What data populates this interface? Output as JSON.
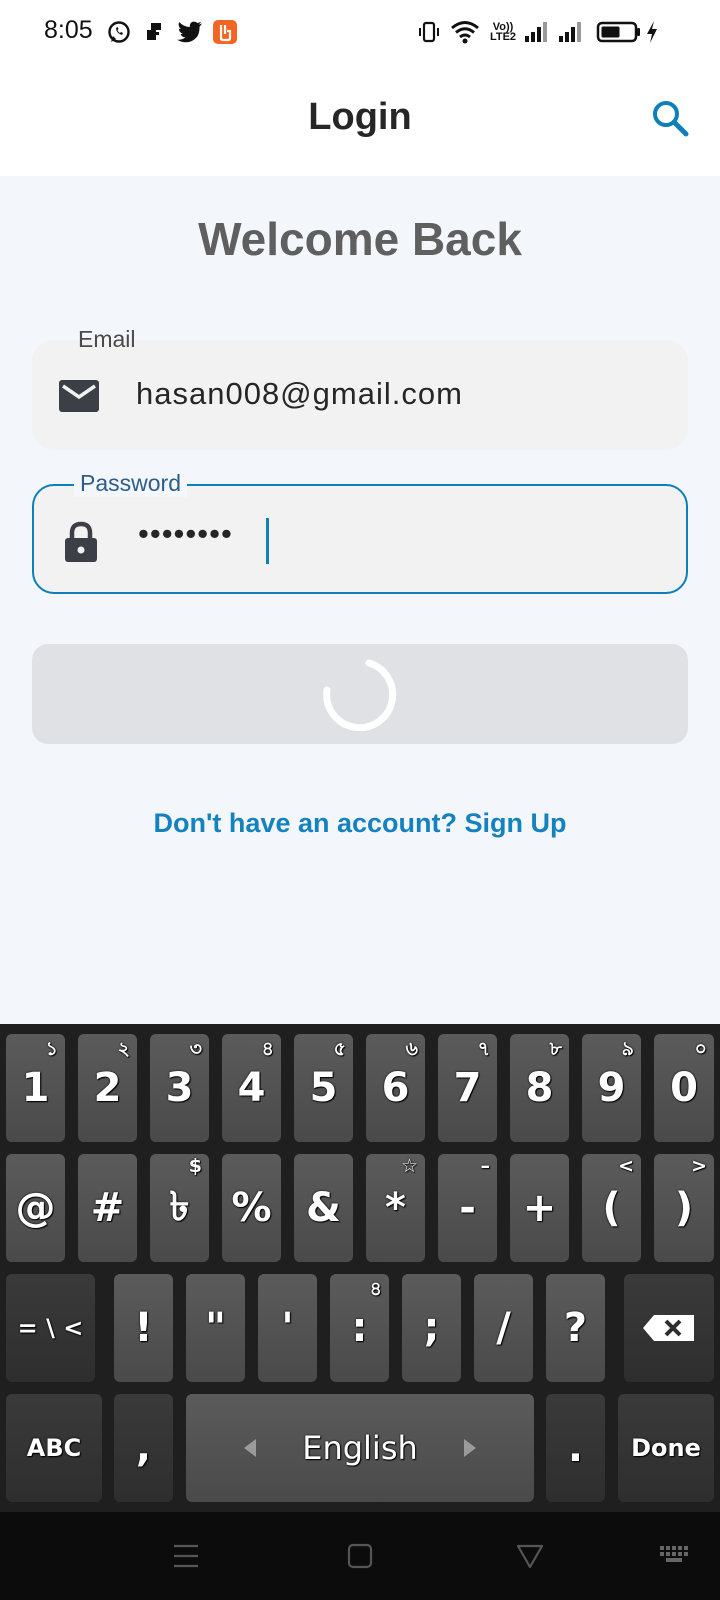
{
  "status_bar": {
    "time": "8:05",
    "notification_icons": [
      "whatsapp-icon",
      "app-notification-icon",
      "twitter-icon",
      "app-orange-icon"
    ],
    "vo_lte_line1": "Vo))",
    "vo_lte_line2": "LTE2",
    "system_icons": [
      "vibrate-icon",
      "wifi-icon",
      "volte-icon",
      "signal-1-icon",
      "signal-2-icon",
      "battery-icon",
      "charging-icon"
    ]
  },
  "app_bar": {
    "title": "Login",
    "action_icon": "search-icon",
    "accent_color": "#0f7fb8"
  },
  "form": {
    "heading": "Welcome Back",
    "email": {
      "label": "Email",
      "value": "hasan008@gmail.com",
      "icon": "mail-icon"
    },
    "password": {
      "label": "Password",
      "value": "••••••••",
      "icon": "lock-icon",
      "focused": true
    },
    "submit": {
      "state": "loading",
      "indicator": "spinner"
    },
    "signup_link": "Don't have an account? Sign Up"
  },
  "keyboard": {
    "row1": [
      {
        "label": "1",
        "hint": "১"
      },
      {
        "label": "2",
        "hint": "২"
      },
      {
        "label": "3",
        "hint": "৩"
      },
      {
        "label": "4",
        "hint": "৪"
      },
      {
        "label": "5",
        "hint": "৫"
      },
      {
        "label": "6",
        "hint": "৬"
      },
      {
        "label": "7",
        "hint": "৭"
      },
      {
        "label": "8",
        "hint": "৮"
      },
      {
        "label": "9",
        "hint": "৯"
      },
      {
        "label": "0",
        "hint": "০"
      }
    ],
    "row2": [
      {
        "label": "@",
        "hint": ""
      },
      {
        "label": "#",
        "hint": ""
      },
      {
        "label": "৳",
        "hint": "$"
      },
      {
        "label": "%",
        "hint": ""
      },
      {
        "label": "&",
        "hint": ""
      },
      {
        "label": "*",
        "hint": "☆"
      },
      {
        "label": "-",
        "hint": "–"
      },
      {
        "label": "+",
        "hint": ""
      },
      {
        "label": "(",
        "hint": "<"
      },
      {
        "label": ")",
        "hint": ">"
      }
    ],
    "row3": [
      {
        "label": "= \\ <",
        "hint": ""
      },
      {
        "label": "!",
        "hint": ""
      },
      {
        "label": "\"",
        "hint": ""
      },
      {
        "label": "'",
        "hint": ""
      },
      {
        "label": ":",
        "hint": "৪"
      },
      {
        "label": ";",
        "hint": ""
      },
      {
        "label": "/",
        "hint": ""
      },
      {
        "label": "?",
        "hint": ""
      }
    ],
    "row4": {
      "abc": "ABC",
      "comma": ",",
      "space": "English",
      "period": ".",
      "done": "Done"
    }
  },
  "nav_bar": {
    "buttons": [
      "menu-icon",
      "home-icon",
      "back-icon",
      "keyboard-icon"
    ]
  }
}
